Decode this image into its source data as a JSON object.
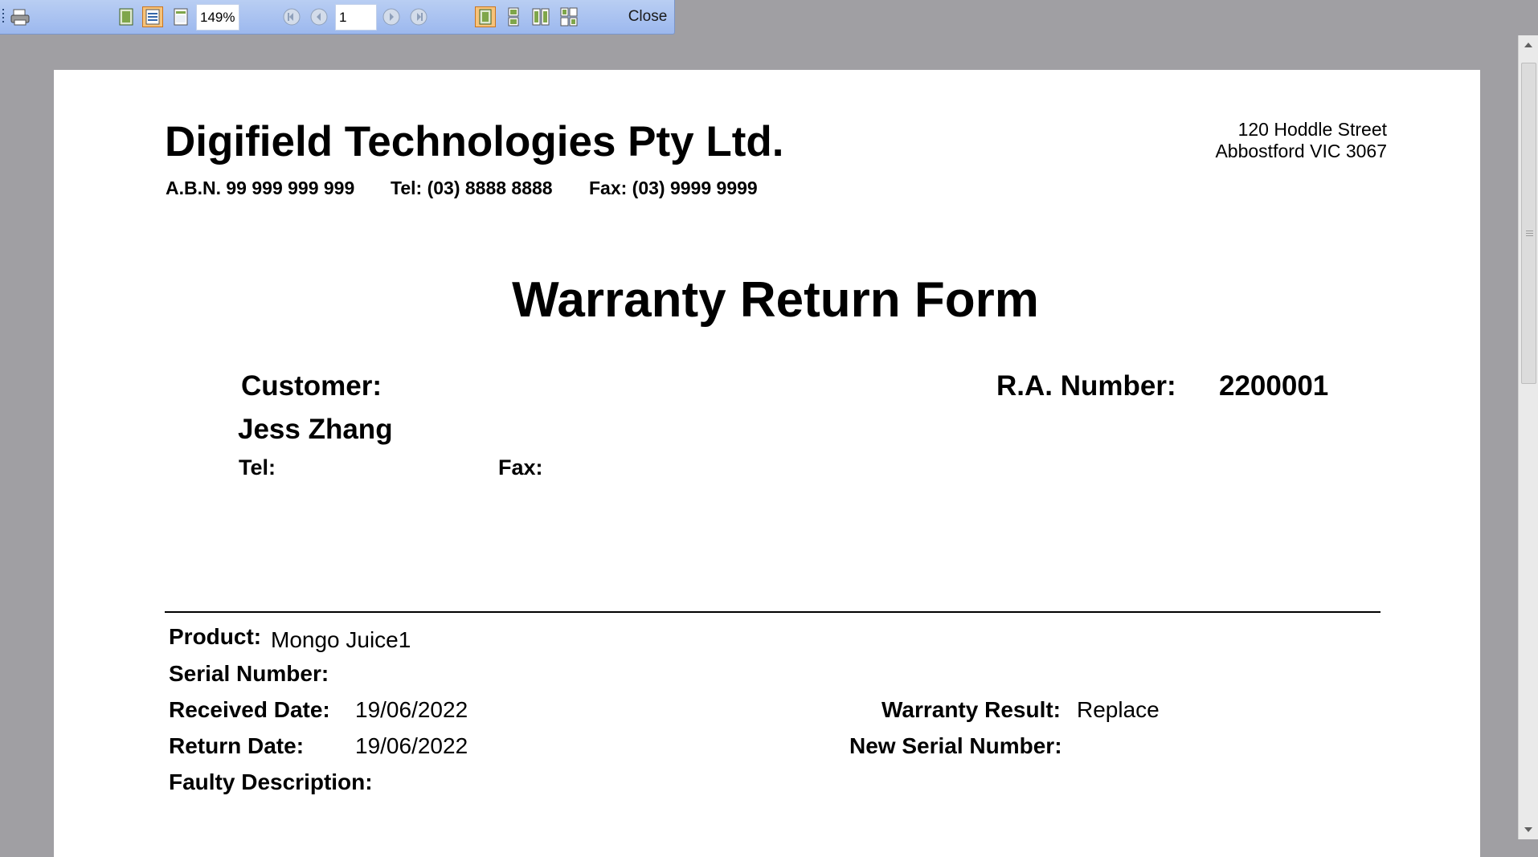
{
  "toolbar": {
    "zoom": "149%",
    "page": "1",
    "close_label": "Close",
    "icons": [
      "printer-icon",
      "single-page-icon",
      "fit-width-icon",
      "whole-page-icon",
      "first-page-icon",
      "previous-page-icon",
      "next-page-icon",
      "last-page-icon",
      "one-page-view-icon",
      "two-page-view-icon",
      "four-page-view-icon",
      "multi-page-view-icon"
    ]
  },
  "header": {
    "company": "Digifield Technologies Pty Ltd.",
    "abn": "A.B.N. 99 999 999 999",
    "tel": "Tel: (03) 8888 8888",
    "fax": "Fax: (03) 9999 9999",
    "address_line1": "120 Hoddle Street",
    "address_line2": "Abbostford VIC 3067"
  },
  "form": {
    "title": "Warranty Return Form",
    "customer_label": "Customer:",
    "customer_name": "Jess Zhang",
    "customer_tel_label": "Tel:",
    "customer_fax_label": "Fax:",
    "ra_label": "R.A. Number:",
    "ra_number": "2200001",
    "product_label": "Product:",
    "product_value": "Mongo Juice1",
    "serial_label": "Serial Number:",
    "received_label": "Received Date:",
    "received_value": "19/06/2022",
    "return_label": "Return Date:",
    "return_value": "19/06/2022",
    "faulty_label": "Faulty Description:",
    "warranty_result_label": "Warranty Result:",
    "warranty_result_value": "Replace",
    "new_serial_label": "New Serial Number:"
  },
  "colors": {
    "toolbar": "#9cb8ee",
    "viewer_background": "#a09fa3",
    "active_button": "#f7c37a"
  }
}
